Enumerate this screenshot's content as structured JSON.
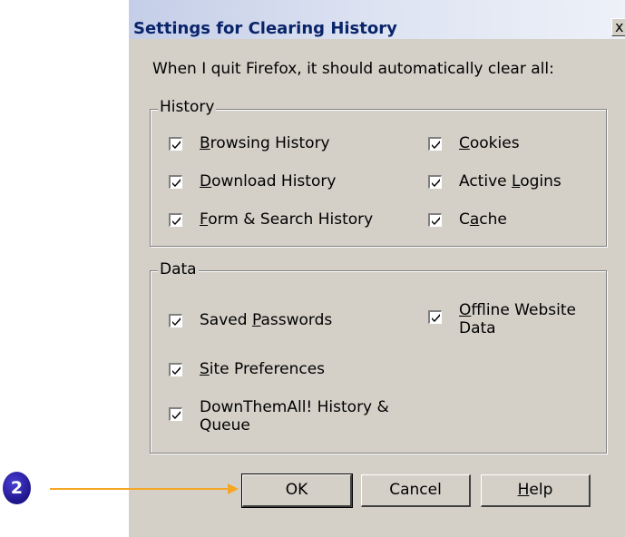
{
  "dialog": {
    "title": "Settings for Clearing History",
    "close_label": "x",
    "intro": "When I quit Firefox, it should automatically clear all:"
  },
  "history_group": {
    "label": "History",
    "items": [
      {
        "pre": "",
        "key": "B",
        "post": "rowsing History",
        "checked": true
      },
      {
        "pre": "",
        "key": "D",
        "post": "ownload History",
        "checked": true
      },
      {
        "pre": "",
        "key": "F",
        "post": "orm & Search History",
        "checked": true
      },
      {
        "pre": "",
        "key": "C",
        "post": "ookies",
        "checked": true
      },
      {
        "pre": "Active ",
        "key": "L",
        "post": "ogins",
        "checked": true
      },
      {
        "pre": "C",
        "key": "a",
        "post": "che",
        "checked": true
      }
    ]
  },
  "data_group": {
    "label": "Data",
    "items": [
      {
        "pre": "Saved ",
        "key": "P",
        "post": "asswords",
        "checked": true
      },
      {
        "pre": "",
        "key": "S",
        "post": "ite Preferences",
        "checked": true
      },
      {
        "pre": "DownThemAll! History & Queue",
        "key": "",
        "post": "",
        "checked": true
      },
      {
        "pre": "",
        "key": "O",
        "post": "ffline Website Data",
        "checked": true
      }
    ]
  },
  "buttons": {
    "ok": "OK",
    "cancel": "Cancel",
    "help_key": "H",
    "help_rest": "elp"
  },
  "annotation": {
    "step_number": "2",
    "arrow_color": "#f5a623",
    "badge_color": "#1e158a"
  }
}
